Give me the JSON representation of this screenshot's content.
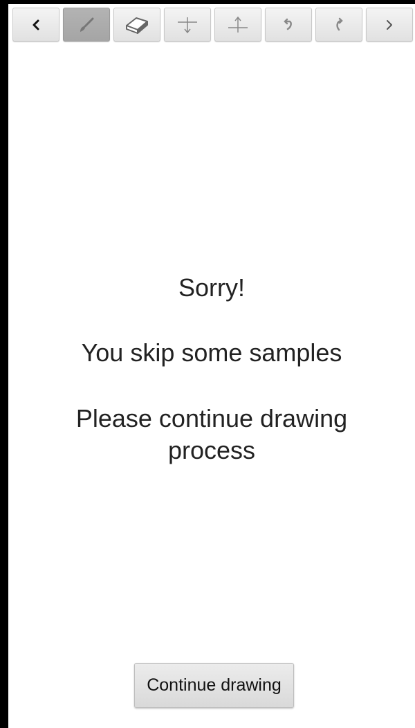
{
  "toolbar": {
    "tools": [
      {
        "id": "back",
        "icon": "chevron-left-icon",
        "state": "normal"
      },
      {
        "id": "brush",
        "icon": "brush-icon",
        "state": "active"
      },
      {
        "id": "eraser",
        "icon": "eraser-icon",
        "state": "normal"
      },
      {
        "id": "insert-below",
        "icon": "arrow-down-line-icon",
        "state": "normal"
      },
      {
        "id": "insert-above",
        "icon": "arrow-up-line-icon",
        "state": "normal"
      },
      {
        "id": "undo",
        "icon": "undo-icon",
        "state": "normal"
      },
      {
        "id": "redo",
        "icon": "redo-icon",
        "state": "normal"
      },
      {
        "id": "forward",
        "icon": "chevron-right-icon",
        "state": "normal"
      }
    ]
  },
  "message": {
    "title": "Sorry!",
    "line": "You skip some samples",
    "instruction": "Please continue drawing process"
  },
  "continue_button": {
    "label": "Continue drawing"
  },
  "colors": {
    "background": "#ffffff",
    "frame": "#000000",
    "button_face": "#e6e6e6",
    "active_tool": "#ababab",
    "icon": "#8a8a8a"
  }
}
